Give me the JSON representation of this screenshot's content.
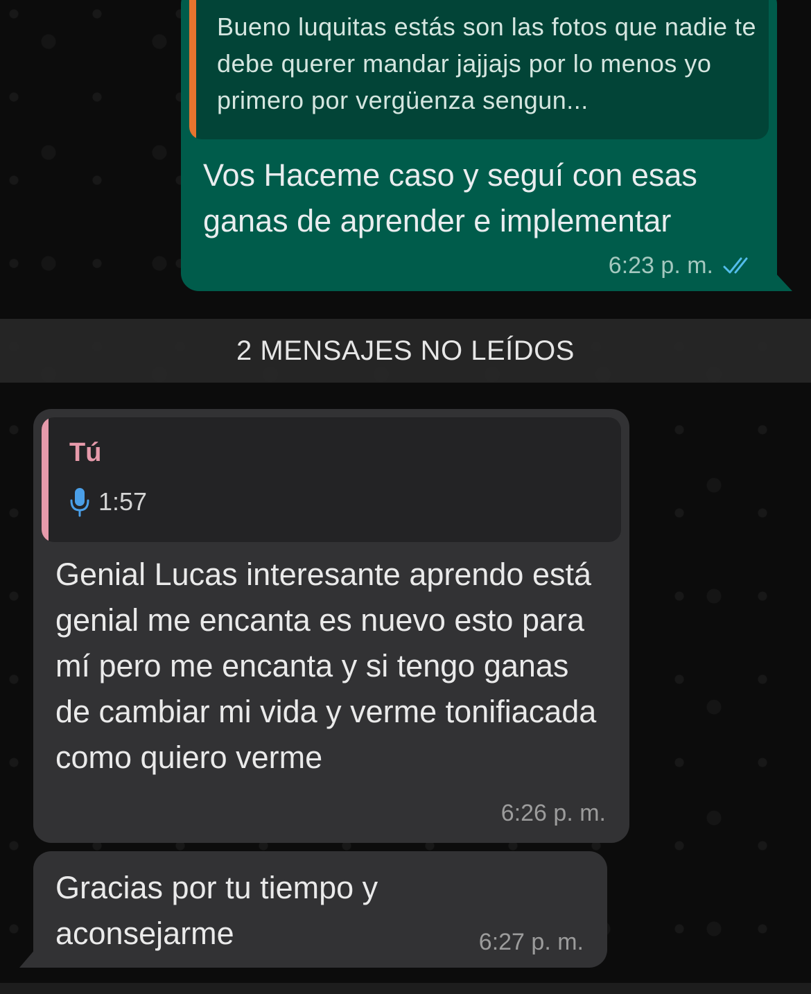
{
  "outgoing_message": {
    "quoted_text": "Bueno luquitas estás son las fotos que nadie te debe querer mandar jajjajs por lo menos yo primero por vergüenza sengun...",
    "text": "Vos Haceme caso y seguí con esas ganas de aprender e implementar",
    "time": "6:23 p. m.",
    "status_icon": "double-check-icon",
    "quote_bar_color": "#e8742e"
  },
  "unread_banner": {
    "label": "2 MENSAJES NO LEÍDOS"
  },
  "incoming_messages": [
    {
      "quoted_author": "Tú",
      "quoted_audio_duration": "1:57",
      "quoted_icon": "microphone-icon",
      "text": "Genial Lucas interesante aprendo está genial me encanta es nuevo esto para mí pero me encanta  y si tengo ganas de cambiar mi vida y verme tonifiacada como quiero verme",
      "time": "6:26 p. m."
    },
    {
      "text": "Gracias por tu tiempo y aconsejarme",
      "time": "6:27 p. m."
    }
  ],
  "colors": {
    "outgoing_bubble": "#005c4b",
    "incoming_bubble": "#323234",
    "read_ticks": "#53bdeb",
    "quote_author": "#e69aab"
  }
}
